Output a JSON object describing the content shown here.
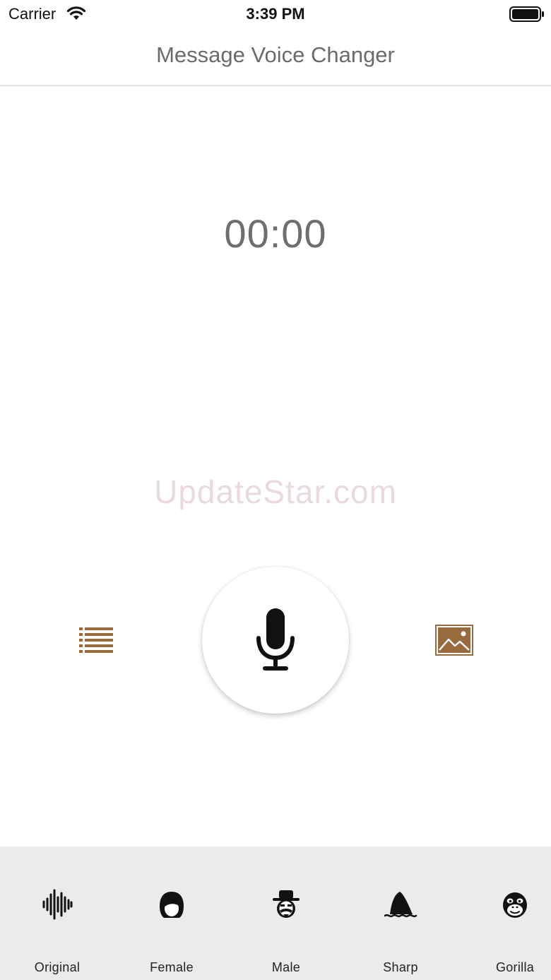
{
  "status_bar": {
    "carrier": "Carrier",
    "time": "3:39 PM",
    "wifi_icon": "wifi-icon",
    "battery_icon": "battery-icon"
  },
  "nav": {
    "title": "Message Voice Changer"
  },
  "recorder": {
    "timer": "00:00",
    "list_icon": "list-icon",
    "record_icon": "microphone-icon",
    "gallery_icon": "image-icon"
  },
  "watermark": "UpdateStar.com",
  "effects": [
    {
      "label": "Original",
      "icon": "waveform-icon"
    },
    {
      "label": "Female",
      "icon": "female-face-icon"
    },
    {
      "label": "Male",
      "icon": "male-face-icon"
    },
    {
      "label": "Sharp",
      "icon": "shark-fin-icon"
    },
    {
      "label": "Gorilla",
      "icon": "gorilla-icon"
    }
  ],
  "colors": {
    "accent_brown": "#9a6a3f",
    "title_gray": "#6b6b6b",
    "effects_bar_bg": "#ebebeb",
    "watermark": "#ead9de"
  }
}
